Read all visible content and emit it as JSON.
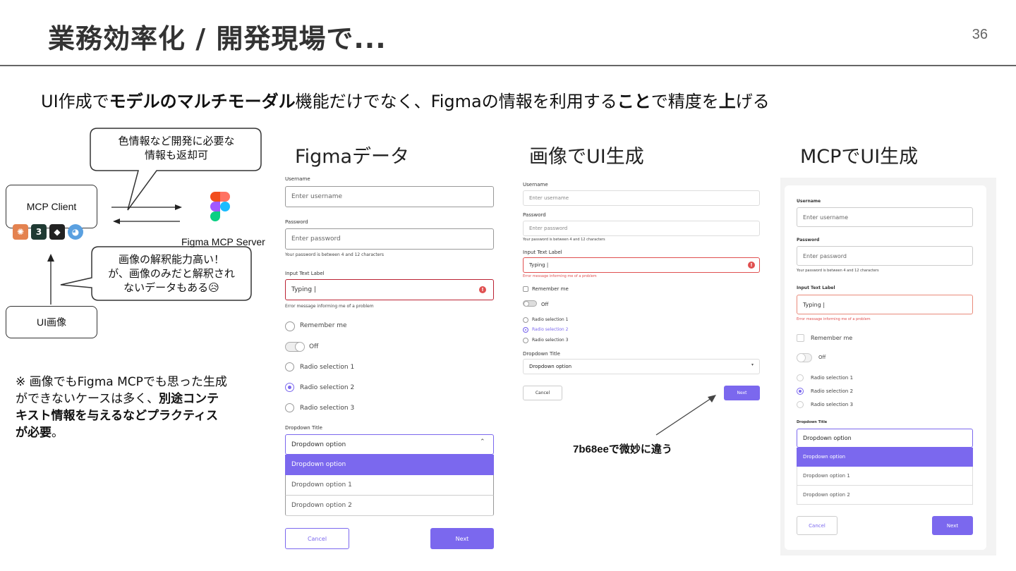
{
  "slide": {
    "title": "業務効率化 / 開発現場で...",
    "page_number": "36",
    "subtitle_parts": [
      {
        "text": "UI作成で",
        "bold": false
      },
      {
        "text": "モデルのマルチモーダル",
        "bold": true
      },
      {
        "text": "機能だけでなく、Figmaの情報を利用する",
        "bold": false
      },
      {
        "text": "こと",
        "bold": true
      },
      {
        "text": "で精度を",
        "bold": false
      },
      {
        "text": "上",
        "bold": true
      },
      {
        "text": "げる",
        "bold": false
      }
    ]
  },
  "diagram": {
    "bubble_top": {
      "line1": "色情報など開発に必要な",
      "line2": "情報も返却可"
    },
    "mcp_client": "MCP Client",
    "figma_server": "Figma MCP Server",
    "bubble_mid": {
      "line1": "画像の解釈能力高い！",
      "line2": "が、画像のみだと解釈され",
      "line3": "ないデータもある😥"
    },
    "ui_image": "UI画像",
    "client_icons": [
      {
        "name": "claude-icon",
        "color": "#e4824f",
        "glyph": "✺"
      },
      {
        "name": "cursor-icon",
        "color": "#1f3a33",
        "glyph": "3"
      },
      {
        "name": "cube-icon",
        "color": "#222222",
        "glyph": "◆"
      },
      {
        "name": "copilot-icon",
        "color": "#5aa0e0",
        "glyph": "◕"
      }
    ]
  },
  "note": {
    "normal": "※ 画像でもFigma MCPでも思った生成ができないケースは多く、",
    "bold": "別途コンテキスト情報を与えるなどプラクティスが必要",
    "end": "。"
  },
  "columns": {
    "figma": "Figmaデータ",
    "image": "画像でUI生成",
    "mcp": "MCPでUI生成"
  },
  "diff_label": "7b68eeで微妙に違う",
  "colors": {
    "accent": "#7b68ee",
    "error": "#e05050"
  },
  "figma_form": {
    "username_label": "Username",
    "username_ph": "Enter username",
    "password_label": "Password",
    "password_ph": "Enter password",
    "password_hint": "Your password is between 4 and 12 characters",
    "input_label": "Input Text Label",
    "input_value": "Typing |",
    "error_msg": "Error message informing me of a problem",
    "remember": "Remember me",
    "toggle": "Off",
    "radios": [
      "Radio selection 1",
      "Radio selection 2",
      "Radio selection 3"
    ],
    "dropdown_title": "Dropdown Title",
    "dropdown_value": "Dropdown option",
    "dropdown_options": [
      "Dropdown option",
      "Dropdown option 1",
      "Dropdown option 2"
    ],
    "cancel": "Cancel",
    "next": "Next"
  },
  "image_form": {
    "username_label": "Username",
    "username_ph": "Enter username",
    "password_label": "Password",
    "password_ph": "Enter password",
    "password_hint": "Your password is between 4 and 12 characters",
    "input_label": "Input Text Label",
    "input_value": "Typing |",
    "error_msg": "Error message informing me of a problem",
    "remember": "Remember me",
    "toggle": "Off",
    "radios": [
      "Radio selection 1",
      "Radio selection 2",
      "Radio selection 3"
    ],
    "dropdown_title": "Dropdown Title",
    "dropdown_value": "Dropdown option",
    "cancel": "Cancel",
    "next": "Next"
  },
  "mcp_form": {
    "username_label": "Username",
    "username_ph": "Enter username",
    "password_label": "Password",
    "password_ph": "Enter password",
    "password_hint": "Your password is between 4 and 12 characters",
    "input_label": "Input Text Label",
    "input_value": "Typing |",
    "error_msg": "Error message informing me of a problem",
    "remember": "Remember me",
    "toggle": "Off",
    "radios": [
      "Radio selection 1",
      "Radio selection 2",
      "Radio selection 3"
    ],
    "dropdown_title": "Dropdown Title",
    "dropdown_value": "Dropdown option",
    "dropdown_options": [
      "Dropdown option",
      "Dropdown option 1",
      "Dropdown option 2"
    ],
    "cancel": "Cancel",
    "next": "Next"
  }
}
